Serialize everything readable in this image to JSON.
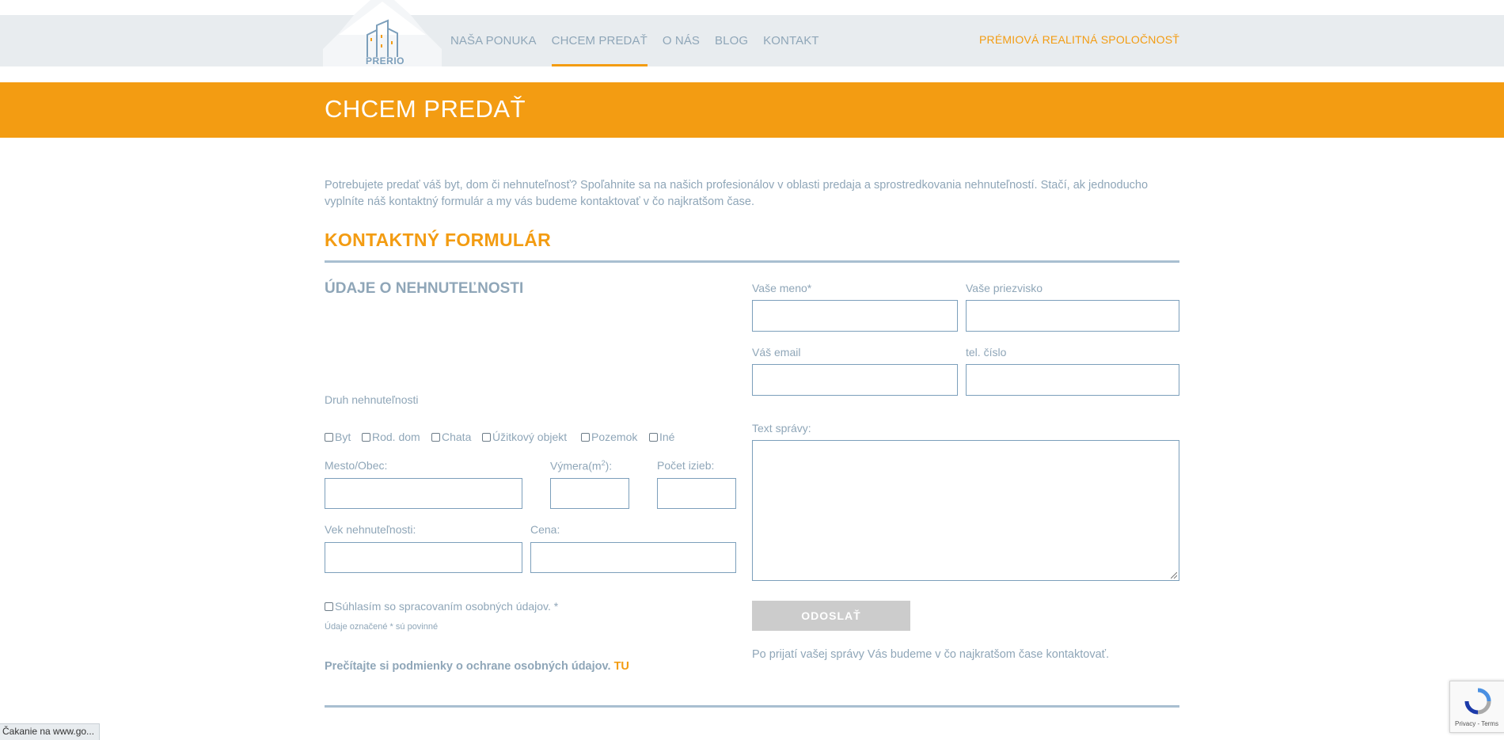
{
  "header": {
    "logo_text": "PRERIO",
    "nav": [
      {
        "label": "NAŠA PONUKA",
        "active": false
      },
      {
        "label": "CHCEM PREDAŤ",
        "active": true
      },
      {
        "label": "O NÁS",
        "active": false
      },
      {
        "label": "BLOG",
        "active": false
      },
      {
        "label": "KONTAKT",
        "active": false
      }
    ],
    "tagline": "PRÉMIOVÁ REALITNÁ SPOLOČNOSŤ"
  },
  "page_title": "CHCEM PREDAŤ",
  "intro": "Potrebujete predať váš byt, dom či nehnuteľnosť? Spoľahnite sa na našich profesionálov v oblasti predaja a sprostredkovania nehnuteľností. Stačí, ak jednoducho vyplníte náš kontaktný formulár a my vás budeme kontaktovať v čo najkratšom čase.",
  "form_title": "KONTAKTNÝ FORMULÁR",
  "property": {
    "heading": "ÚDAJE O NEHNUTEĽNOSTI",
    "type_label": "Druh nehnuteľnosti",
    "types": [
      "Byt",
      "Rod. dom",
      "Chata",
      "Úžitkový objekt",
      "Pozemok",
      "Iné"
    ],
    "city_label": "Mesto/Obec:",
    "area_label": "Výmera(m",
    "area_sup": "2",
    "area_suffix": "):",
    "rooms_label": "Počet izieb:",
    "age_label": "Vek nehnuteľnosti:",
    "price_label": "Cena:",
    "consent_label": "Súhlasím so spracovaním osobných údajov. *",
    "required_note": "Údaje označené * sú povinné",
    "privacy_text": "Prečítajte si podmienky o ochrane osobných údajov.",
    "privacy_link": "TU"
  },
  "contact": {
    "name_label": "Vaše meno*",
    "surname_label": "Vaše priezvisko",
    "email_label": "Váš email",
    "phone_label": "tel. číslo",
    "message_label": "Text správy:",
    "submit_label": "ODOSLAŤ",
    "after_note": "Po prijatí vašej správy Vás budeme v čo najkratšom čase kontaktovať."
  },
  "status_bar": "Čakanie na www.go...",
  "recaptcha_terms": "Privacy - Terms",
  "colors": {
    "accent": "#f39c12",
    "text": "#8fa6b8",
    "band": "#e8ecef",
    "rule": "#a9bfd1"
  }
}
